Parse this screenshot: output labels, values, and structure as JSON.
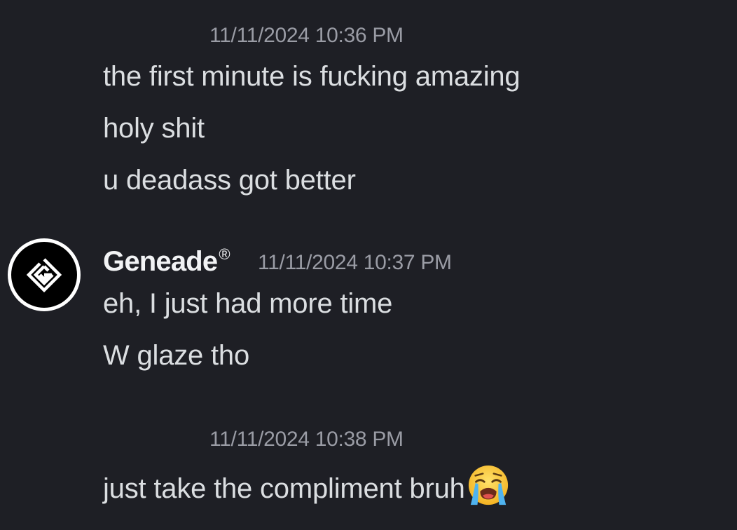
{
  "group1": {
    "timestamp": "11/11/2024 10:36 PM",
    "messages": [
      "the first minute is fucking amazing",
      "holy shit",
      "u deadass got better"
    ]
  },
  "group2": {
    "author": "Geneade",
    "author_badge": "®",
    "avatar_icon": "geneade-logo-icon",
    "timestamp": "11/11/2024 10:37 PM",
    "messages": [
      "eh, I just had more time",
      "W glaze tho"
    ]
  },
  "group3": {
    "timestamp": "11/11/2024 10:38 PM",
    "messages": [
      "just take the compliment bruh"
    ],
    "emoji": "loudly-crying-face-emoji"
  },
  "colors": {
    "background": "#1e1f25",
    "message_text": "#dbdee1",
    "timestamp_text": "#9a9ca5",
    "author_text": "#f2f3f5"
  }
}
